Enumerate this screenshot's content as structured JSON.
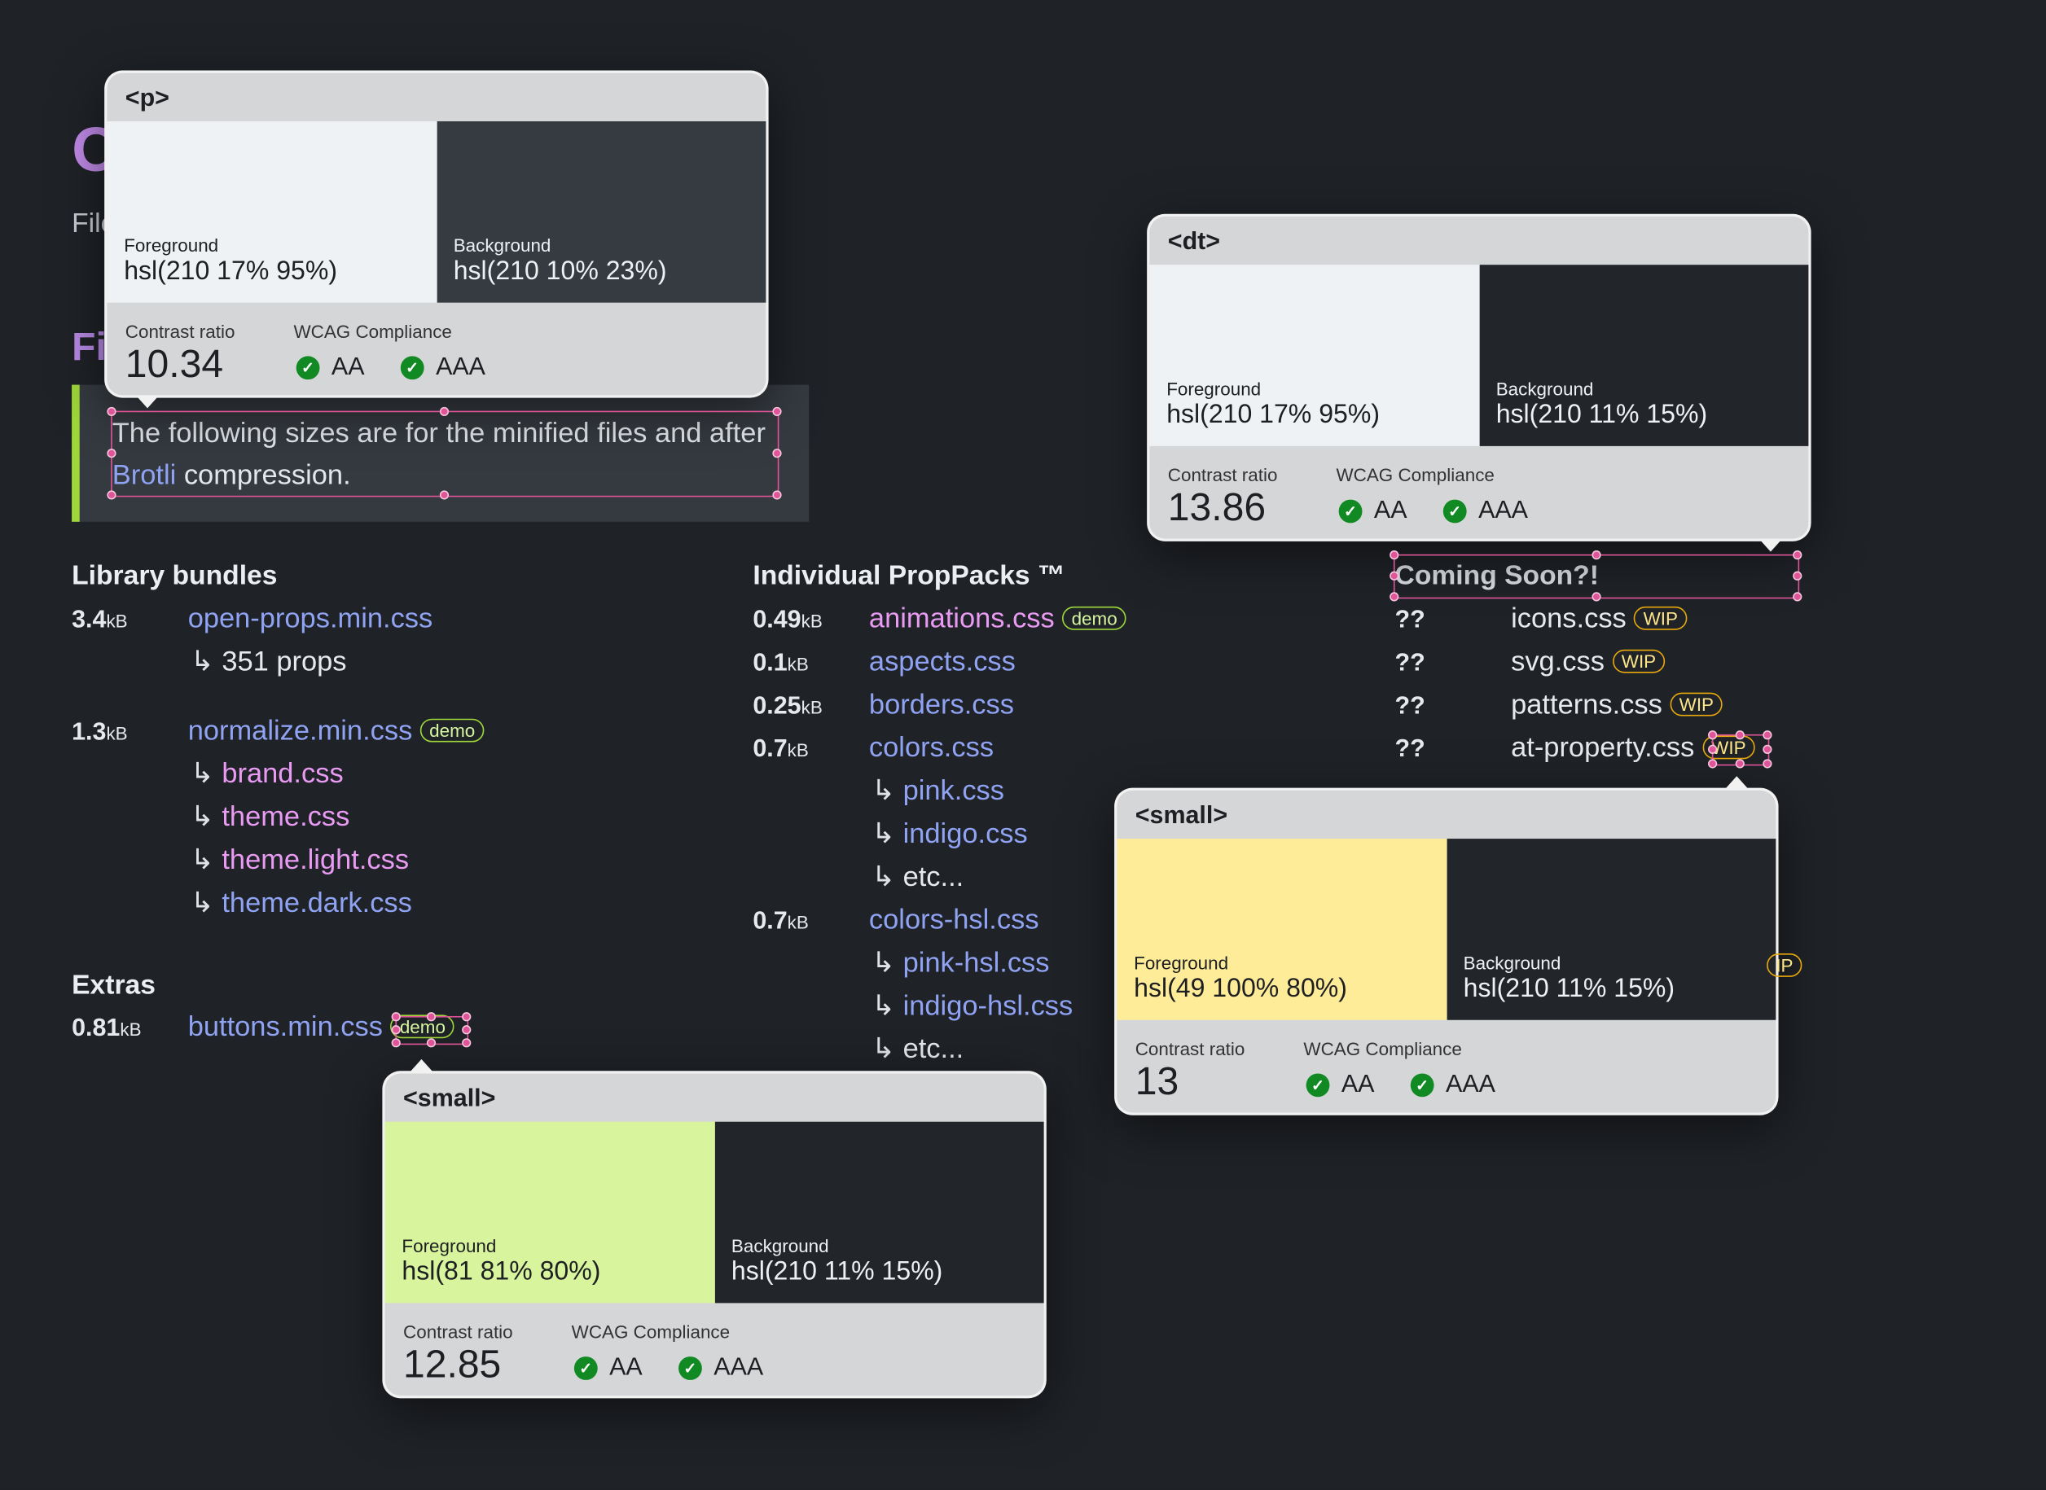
{
  "page": {
    "heading_fragment": "O",
    "subtitle_fragment": "File",
    "section_fragment": "Fi",
    "note": {
      "before": "The following sizes are for the minified files and after ",
      "link": "Brotli",
      "after": " compression."
    }
  },
  "library": {
    "title": "Library bundles",
    "rows": [
      {
        "size": "3.4",
        "unit": "kB",
        "file": "open-props.min.css",
        "color": "blue",
        "subs": [
          {
            "name": "351 props",
            "color": "plain"
          }
        ]
      },
      {
        "size": "1.3",
        "unit": "kB",
        "file": "normalize.min.css",
        "color": "blue",
        "badge": "demo",
        "subs": [
          {
            "name": "brand.css",
            "color": "pink"
          },
          {
            "name": "theme.css",
            "color": "pink"
          },
          {
            "name": "theme.light.css",
            "color": "pink"
          },
          {
            "name": "theme.dark.css",
            "color": "blue"
          }
        ]
      }
    ]
  },
  "extras": {
    "title": "Extras",
    "rows": [
      {
        "size": "0.81",
        "unit": "kB",
        "file": "buttons.min.css",
        "color": "blue",
        "badge": "demo",
        "subs": []
      }
    ]
  },
  "proppacks": {
    "title": "Individual PropPacks ™",
    "rows": [
      {
        "size": "0.49",
        "unit": "kB",
        "file": "animations.css",
        "color": "pink",
        "badge": "demo",
        "subs": []
      },
      {
        "size": "0.1",
        "unit": "kB",
        "file": "aspects.css",
        "color": "blue",
        "subs": []
      },
      {
        "size": "0.25",
        "unit": "kB",
        "file": "borders.css",
        "color": "blue",
        "subs": []
      },
      {
        "size": "0.7",
        "unit": "kB",
        "file": "colors.css",
        "color": "blue",
        "subs": [
          {
            "name": "pink.css",
            "color": "blue"
          },
          {
            "name": "indigo.css",
            "color": "blue"
          },
          {
            "name": "etc...",
            "color": "plain"
          }
        ]
      },
      {
        "size": "0.7",
        "unit": "kB",
        "file": "colors-hsl.css",
        "color": "blue",
        "subs": [
          {
            "name": "pink-hsl.css",
            "color": "blue"
          },
          {
            "name": "indigo-hsl.css",
            "color": "blue"
          },
          {
            "name": "etc...",
            "color": "plain"
          }
        ]
      }
    ]
  },
  "coming_soon": {
    "title": "Coming Soon?!",
    "rows": [
      {
        "size": "??",
        "file": "icons.css",
        "badge": "WIP"
      },
      {
        "size": "??",
        "file": "svg.css",
        "badge": "WIP"
      },
      {
        "size": "??",
        "file": "patterns.css",
        "badge": "WIP"
      },
      {
        "size": "??",
        "file": "at-property.css",
        "badge": "WIP"
      }
    ]
  },
  "popovers": [
    {
      "tag": "<p>",
      "fg_label": "Foreground",
      "fg": "hsl(210 17% 95%)",
      "fg_hex": "#eff2f5",
      "bg_label": "Background",
      "bg": "hsl(210 10% 23%)",
      "bg_hex": "#353b41",
      "ratio_label": "Contrast ratio",
      "ratio": "10.34",
      "wcag_label": "WCAG Compliance",
      "levels": [
        "AA",
        "AAA"
      ]
    },
    {
      "tag": "<dt>",
      "fg_label": "Foreground",
      "fg": "hsl(210 17% 95%)",
      "fg_hex": "#eff2f5",
      "bg_label": "Background",
      "bg": "hsl(210 11% 15%)",
      "bg_hex": "#22262b",
      "ratio_label": "Contrast ratio",
      "ratio": "13.86",
      "wcag_label": "WCAG Compliance",
      "levels": [
        "AA",
        "AAA"
      ]
    },
    {
      "tag": "<small>",
      "fg_label": "Foreground",
      "fg": "hsl(49 100% 80%)",
      "fg_hex": "#ffec99",
      "bg_label": "Background",
      "bg": "hsl(210 11% 15%)",
      "bg_hex": "#22262b",
      "ratio_label": "Contrast ratio",
      "ratio": "13",
      "wcag_label": "WCAG Compliance",
      "levels": [
        "AA",
        "AAA"
      ]
    },
    {
      "tag": "<small>",
      "fg_label": "Foreground",
      "fg": "hsl(81 81% 80%)",
      "fg_hex": "#d8f59e",
      "bg_label": "Background",
      "bg": "hsl(210 11% 15%)",
      "bg_hex": "#22262b",
      "ratio_label": "Contrast ratio",
      "ratio": "12.85",
      "wcag_label": "WCAG Compliance",
      "levels": [
        "AA",
        "AAA"
      ]
    }
  ],
  "colors": {
    "link_blue": "#8fa3f2",
    "link_pink": "#e99af2",
    "selection": "#e0559a",
    "quote_border": "#9fd83a"
  }
}
